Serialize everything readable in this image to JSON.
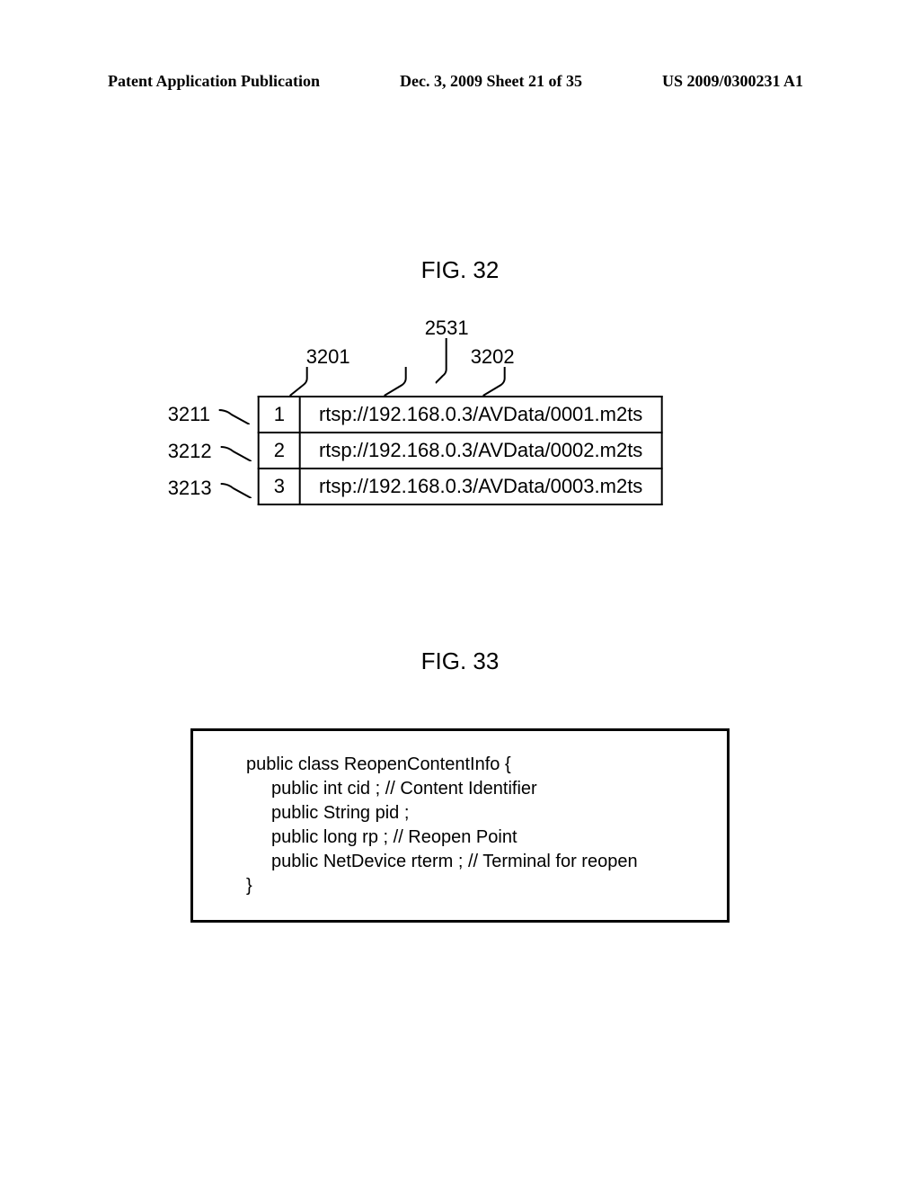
{
  "header": {
    "left": "Patent Application Publication",
    "center": "Dec. 3, 2009  Sheet 21 of 35",
    "right": "US 2009/0300231 A1"
  },
  "fig32": {
    "title": "FIG. 32",
    "topLabel": "2531",
    "col1Label": "3201",
    "col2Label": "3202",
    "rows": [
      {
        "label": "3211",
        "num": "1",
        "url": "rtsp://192.168.0.3/AVData/0001.m2ts"
      },
      {
        "label": "3212",
        "num": "2",
        "url": "rtsp://192.168.0.3/AVData/0002.m2ts"
      },
      {
        "label": "3213",
        "num": "3",
        "url": "rtsp://192.168.0.3/AVData/0003.m2ts"
      }
    ]
  },
  "fig33": {
    "title": "FIG. 33",
    "lines": [
      {
        "cls": "l1",
        "t": "public class ReopenContentInfo {"
      },
      {
        "cls": "l2",
        "t": "public int cid ; // Content Identifier"
      },
      {
        "cls": "l2",
        "t": "public String pid ;"
      },
      {
        "cls": "l2",
        "t": "public long rp ; // Reopen Point"
      },
      {
        "cls": "l2",
        "t": "public NetDevice rterm ; // Terminal for reopen"
      },
      {
        "cls": "l1",
        "t": "}"
      }
    ]
  }
}
